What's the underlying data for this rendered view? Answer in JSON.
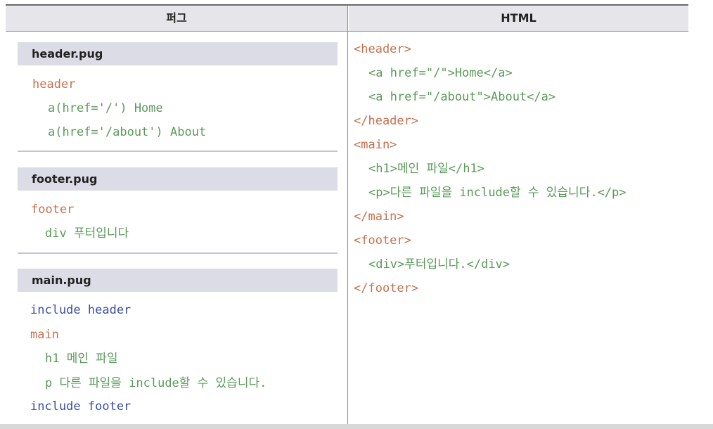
{
  "header": {
    "left": "퍼그",
    "right": "HTML"
  },
  "files": [
    {
      "name": "header.pug"
    },
    {
      "name": "footer.pug"
    },
    {
      "name": "main.pug"
    }
  ],
  "pug": {
    "header_lines": [
      "header",
      "a(href='/') Home",
      "a(href='/about') About"
    ],
    "footer_lines": [
      "footer",
      "div 푸터입니다"
    ],
    "main_lines": [
      "include header",
      "main",
      "h1 메인 파일",
      "p 다른 파일을 include할 수 있습니다.",
      "include footer"
    ]
  },
  "html_lines": [
    "<header>",
    "<a href=\"/\">Home</a>",
    "<a href=\"/about\">About</a>",
    "</header>",
    "<main>",
    "<h1>메인 파일</h1>",
    "<p>다른 파일을 include할 수 있습니다.</p>",
    "</main>",
    "<footer>",
    "<div>푸터입니다.</div>",
    "</footer>"
  ]
}
